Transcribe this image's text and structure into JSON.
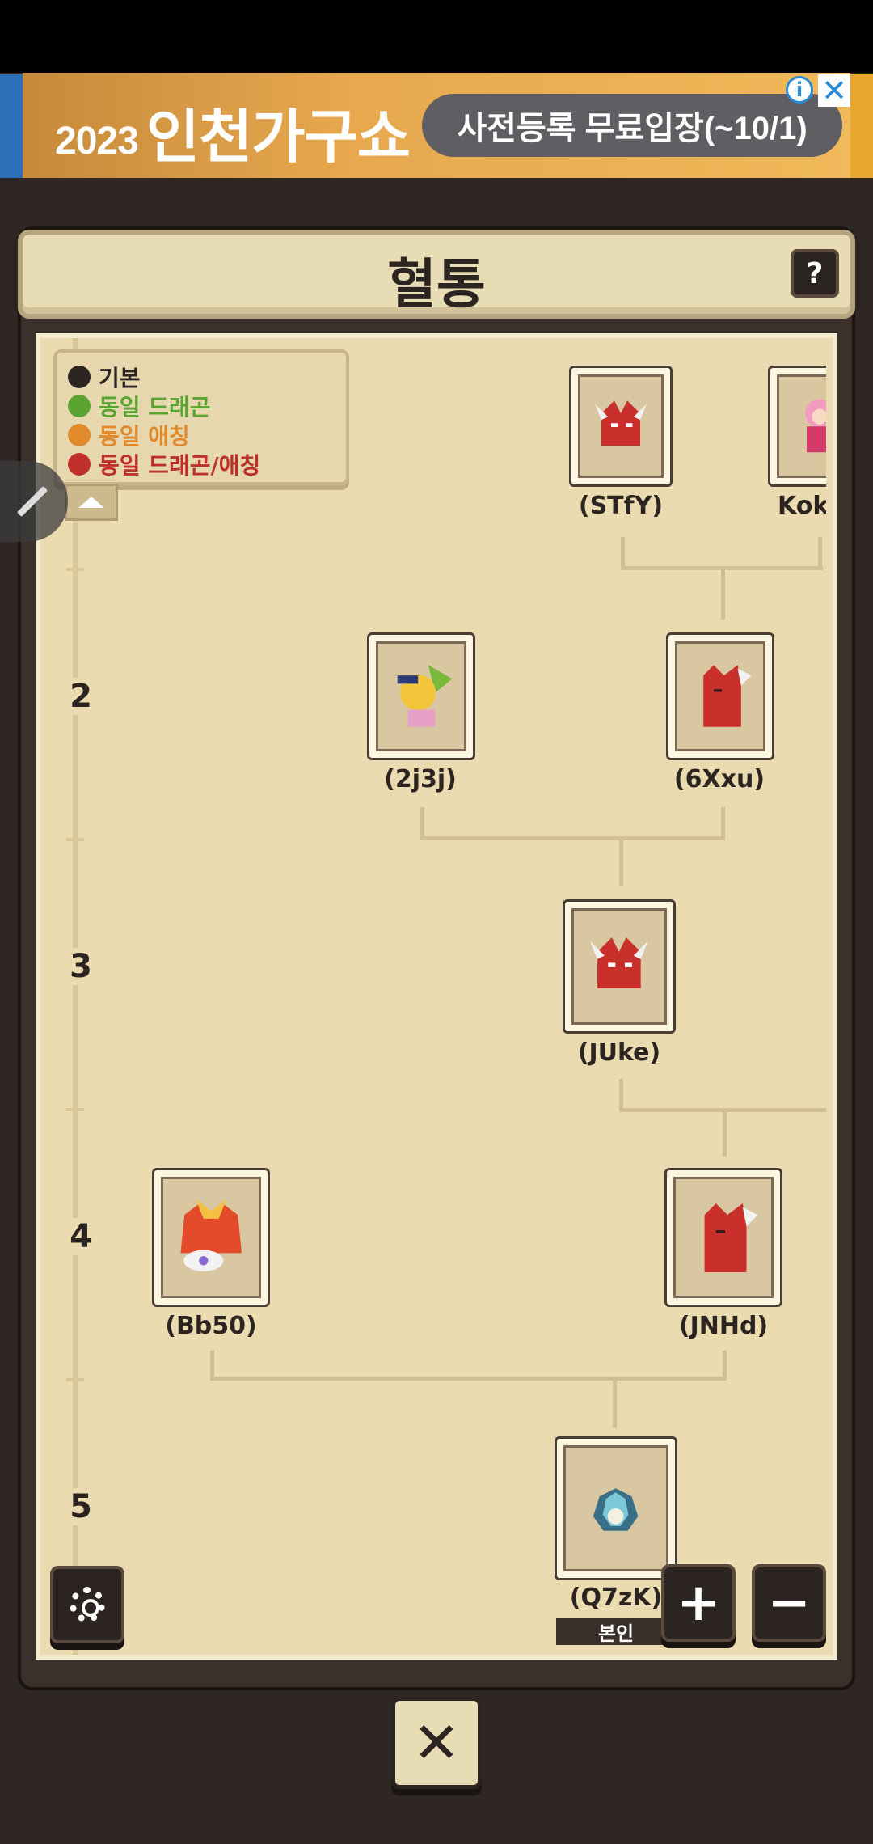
{
  "ad": {
    "year": "2023",
    "title": "인천가구쇼",
    "cta": "사전등록 무료입장(~10/1)",
    "info_glyph": "i",
    "close_glyph": "✕"
  },
  "header": {
    "title": "혈통",
    "help_label": "?"
  },
  "legend": {
    "items": [
      {
        "label": "기본",
        "color": "#2c2420"
      },
      {
        "label": "동일 드래곤",
        "color": "#5aa532"
      },
      {
        "label": "동일 애칭",
        "color": "#e08a2c"
      },
      {
        "label": "동일 드래곤/애칭",
        "color": "#c0302a"
      }
    ]
  },
  "generations": [
    "2",
    "3",
    "4",
    "5"
  ],
  "tree": {
    "nodes": [
      {
        "label": "(STfY)",
        "dragon": "red-dragon-icon"
      },
      {
        "label": "Kok",
        "dragon": "pink-dragon-icon"
      },
      {
        "label": "(2j3j)",
        "dragon": "yellow-dragon-icon"
      },
      {
        "label": "(6Xxu)",
        "dragon": "red-dragon-icon"
      },
      {
        "label": "(JUke)",
        "dragon": "red-dragon-icon"
      },
      {
        "label": "(Bb50)",
        "dragon": "fire-dragon-icon"
      },
      {
        "label": "(JNHd)",
        "dragon": "red-dragon-icon"
      },
      {
        "label": "(Q7zK)",
        "dragon": "egg-icon"
      }
    ],
    "self_tag": "본인"
  },
  "controls": {
    "zoom_in": "+",
    "zoom_out": "−",
    "close": "✕"
  },
  "colors": {
    "board": "#eadbb1",
    "panel": "#3b302a",
    "connector": "#d2c095"
  }
}
